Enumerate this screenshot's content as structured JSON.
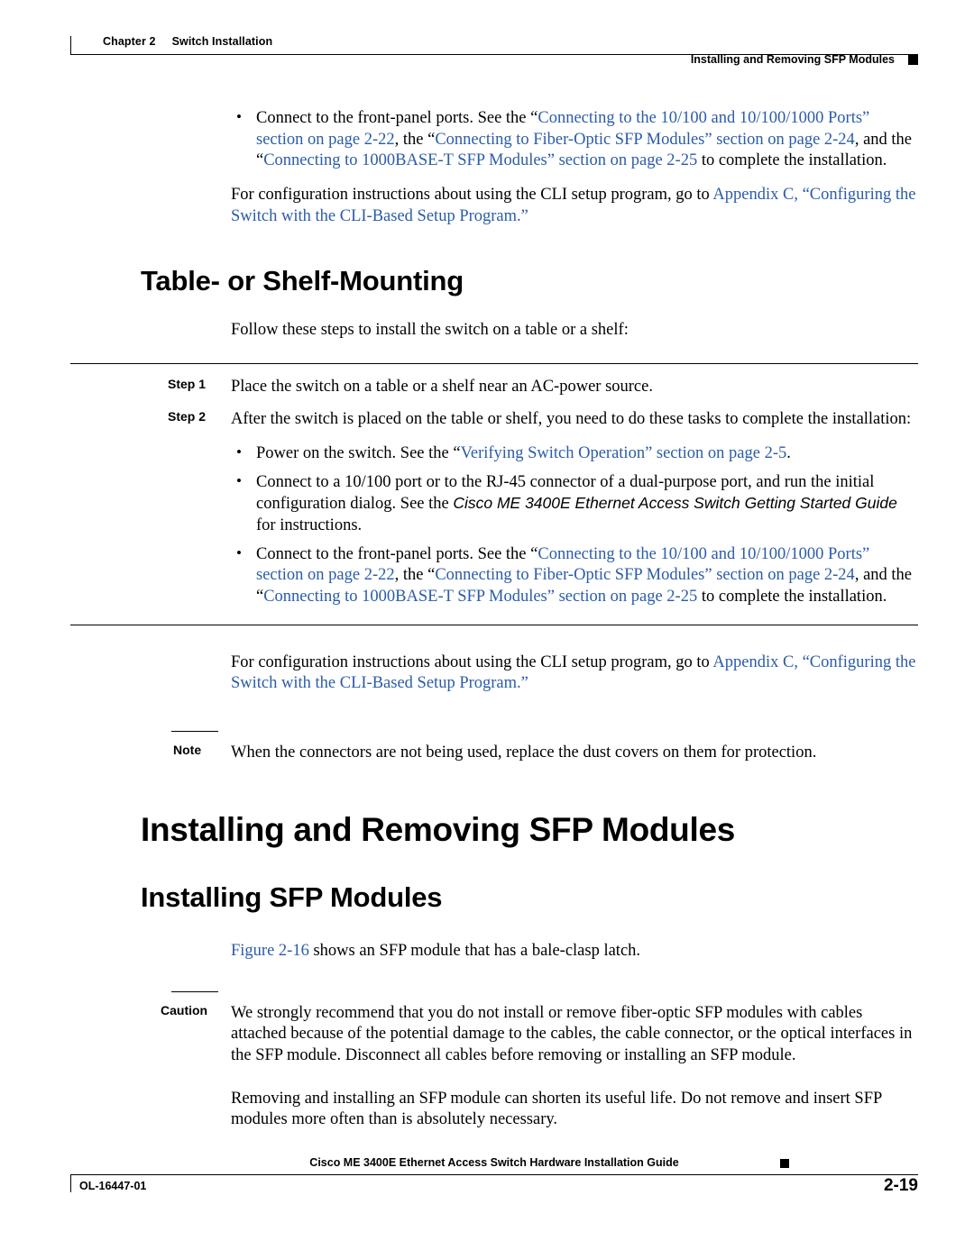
{
  "header": {
    "chapter": "Chapter 2",
    "chapter_title": "Switch Installation",
    "running_head": "Installing and Removing SFP Modules"
  },
  "top_bullets": [
    {
      "segments": [
        {
          "text": "Connect to the front-panel ports. See the “",
          "link": false
        },
        {
          "text": "Connecting to the 10/100 and 10/100/1000 Ports” section on page 2-22",
          "link": true
        },
        {
          "text": ", the “",
          "link": false
        },
        {
          "text": "Connecting to Fiber-Optic SFP Modules” section on page 2-24",
          "link": true
        },
        {
          "text": ", and the “",
          "link": false
        },
        {
          "text": "Connecting to 1000BASE-T SFP Modules” section on page 2-25",
          "link": true
        },
        {
          "text": " to complete the installation.",
          "link": false
        }
      ]
    }
  ],
  "top_paragraph": {
    "segments": [
      {
        "text": "For configuration instructions about using the CLI setup program, go to ",
        "link": false
      },
      {
        "text": "Appendix C, “Configuring the Switch with the CLI-Based Setup Program.”",
        "link": true
      }
    ]
  },
  "section_table_shelf": {
    "title": "Table- or Shelf-Mounting",
    "intro": "Follow these steps to install the switch on a table or a shelf:",
    "steps": [
      {
        "label": "Step 1",
        "text": "Place the switch on a table or a shelf near an AC-power source."
      },
      {
        "label": "Step 2",
        "text": "After the switch is placed on the table or shelf, you need to do these tasks to complete the installation:"
      }
    ],
    "step2_bullets": [
      {
        "segments": [
          {
            "text": "Power on the switch. See the “",
            "link": false
          },
          {
            "text": "Verifying Switch Operation” section on page 2-5",
            "link": true
          },
          {
            "text": ".",
            "link": false
          }
        ]
      },
      {
        "segments": [
          {
            "text": "Connect to a 10/100 port or to the RJ-45 connector of a dual-purpose port, and run the initial configuration dialog. See the ",
            "link": false
          },
          {
            "text": "Cisco ME 3400E Ethernet Access Switch Getting Started Guide",
            "link": false,
            "style": "sans-italic"
          },
          {
            "text": " for instructions.",
            "link": false
          }
        ]
      },
      {
        "segments": [
          {
            "text": "Connect to the front-panel ports. See the “",
            "link": false
          },
          {
            "text": "Connecting to the 10/100 and 10/100/1000 Ports” section on page 2-22",
            "link": true
          },
          {
            "text": ", the “",
            "link": false
          },
          {
            "text": "Connecting to Fiber-Optic SFP Modules” section on page 2-24",
            "link": true
          },
          {
            "text": ", and the “",
            "link": false
          },
          {
            "text": "Connecting to 1000BASE-T SFP Modules” section on page 2-25",
            "link": true
          },
          {
            "text": " to complete the installation.",
            "link": false
          }
        ]
      }
    ],
    "after_steps_paragraph": {
      "segments": [
        {
          "text": "For configuration instructions about using the CLI setup program, go to ",
          "link": false
        },
        {
          "text": "Appendix C, “Configuring the Switch with the CLI-Based Setup Program.”",
          "link": true
        }
      ]
    },
    "note": {
      "label": "Note",
      "text": "When the connectors are not being used, replace the dust covers on them for protection."
    }
  },
  "chapter_heading": "Installing and Removing SFP Modules",
  "section_installing_sfp": {
    "title": "Installing SFP Modules",
    "figure_ref": {
      "segments": [
        {
          "text": "Figure 2-16",
          "link": true
        },
        {
          "text": " shows an SFP module that has a bale-clasp latch.",
          "link": false
        }
      ]
    },
    "caution": {
      "label": "Caution",
      "text": "We strongly recommend that you do not install or remove fiber-optic SFP modules with cables attached because of the potential damage to the cables, the cable connector, or the optical interfaces in the SFP module. Disconnect all cables before removing or installing an SFP module."
    },
    "after_caution": "Removing and installing an SFP module can shorten its useful life. Do not remove and insert SFP modules more often than is absolutely necessary."
  },
  "footer": {
    "title": "Cisco ME 3400E Ethernet Access Switch Hardware Installation Guide",
    "doc_id": "OL-16447-01",
    "page_number": "2-19"
  },
  "colors": {
    "link": "#2b5ca8",
    "text": "#000000",
    "background": "#ffffff"
  }
}
